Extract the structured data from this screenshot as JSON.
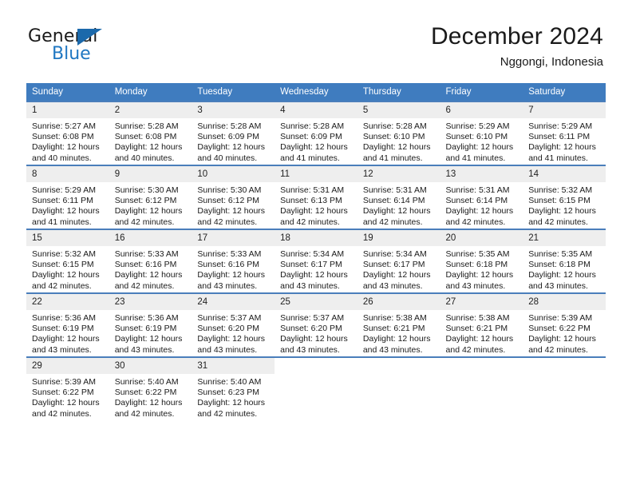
{
  "brand": {
    "name_part1": "General",
    "name_part2": "Blue"
  },
  "header": {
    "title": "December 2024",
    "subtitle": "Nggongi, Indonesia"
  },
  "calendar": {
    "weekday_headers": [
      "Sunday",
      "Monday",
      "Tuesday",
      "Wednesday",
      "Thursday",
      "Friday",
      "Saturday"
    ],
    "colors": {
      "header_bg": "#3f7cbf",
      "header_text": "#ffffff",
      "daynum_bg": "#eeeeee",
      "row_rule": "#4a7ebb",
      "brand_blue": "#1f77c2"
    },
    "weeks": [
      [
        {
          "day": "1",
          "sunrise": "Sunrise: 5:27 AM",
          "sunset": "Sunset: 6:08 PM",
          "daylight1": "Daylight: 12 hours",
          "daylight2": "and 40 minutes."
        },
        {
          "day": "2",
          "sunrise": "Sunrise: 5:28 AM",
          "sunset": "Sunset: 6:08 PM",
          "daylight1": "Daylight: 12 hours",
          "daylight2": "and 40 minutes."
        },
        {
          "day": "3",
          "sunrise": "Sunrise: 5:28 AM",
          "sunset": "Sunset: 6:09 PM",
          "daylight1": "Daylight: 12 hours",
          "daylight2": "and 40 minutes."
        },
        {
          "day": "4",
          "sunrise": "Sunrise: 5:28 AM",
          "sunset": "Sunset: 6:09 PM",
          "daylight1": "Daylight: 12 hours",
          "daylight2": "and 41 minutes."
        },
        {
          "day": "5",
          "sunrise": "Sunrise: 5:28 AM",
          "sunset": "Sunset: 6:10 PM",
          "daylight1": "Daylight: 12 hours",
          "daylight2": "and 41 minutes."
        },
        {
          "day": "6",
          "sunrise": "Sunrise: 5:29 AM",
          "sunset": "Sunset: 6:10 PM",
          "daylight1": "Daylight: 12 hours",
          "daylight2": "and 41 minutes."
        },
        {
          "day": "7",
          "sunrise": "Sunrise: 5:29 AM",
          "sunset": "Sunset: 6:11 PM",
          "daylight1": "Daylight: 12 hours",
          "daylight2": "and 41 minutes."
        }
      ],
      [
        {
          "day": "8",
          "sunrise": "Sunrise: 5:29 AM",
          "sunset": "Sunset: 6:11 PM",
          "daylight1": "Daylight: 12 hours",
          "daylight2": "and 41 minutes."
        },
        {
          "day": "9",
          "sunrise": "Sunrise: 5:30 AM",
          "sunset": "Sunset: 6:12 PM",
          "daylight1": "Daylight: 12 hours",
          "daylight2": "and 42 minutes."
        },
        {
          "day": "10",
          "sunrise": "Sunrise: 5:30 AM",
          "sunset": "Sunset: 6:12 PM",
          "daylight1": "Daylight: 12 hours",
          "daylight2": "and 42 minutes."
        },
        {
          "day": "11",
          "sunrise": "Sunrise: 5:31 AM",
          "sunset": "Sunset: 6:13 PM",
          "daylight1": "Daylight: 12 hours",
          "daylight2": "and 42 minutes."
        },
        {
          "day": "12",
          "sunrise": "Sunrise: 5:31 AM",
          "sunset": "Sunset: 6:14 PM",
          "daylight1": "Daylight: 12 hours",
          "daylight2": "and 42 minutes."
        },
        {
          "day": "13",
          "sunrise": "Sunrise: 5:31 AM",
          "sunset": "Sunset: 6:14 PM",
          "daylight1": "Daylight: 12 hours",
          "daylight2": "and 42 minutes."
        },
        {
          "day": "14",
          "sunrise": "Sunrise: 5:32 AM",
          "sunset": "Sunset: 6:15 PM",
          "daylight1": "Daylight: 12 hours",
          "daylight2": "and 42 minutes."
        }
      ],
      [
        {
          "day": "15",
          "sunrise": "Sunrise: 5:32 AM",
          "sunset": "Sunset: 6:15 PM",
          "daylight1": "Daylight: 12 hours",
          "daylight2": "and 42 minutes."
        },
        {
          "day": "16",
          "sunrise": "Sunrise: 5:33 AM",
          "sunset": "Sunset: 6:16 PM",
          "daylight1": "Daylight: 12 hours",
          "daylight2": "and 42 minutes."
        },
        {
          "day": "17",
          "sunrise": "Sunrise: 5:33 AM",
          "sunset": "Sunset: 6:16 PM",
          "daylight1": "Daylight: 12 hours",
          "daylight2": "and 43 minutes."
        },
        {
          "day": "18",
          "sunrise": "Sunrise: 5:34 AM",
          "sunset": "Sunset: 6:17 PM",
          "daylight1": "Daylight: 12 hours",
          "daylight2": "and 43 minutes."
        },
        {
          "day": "19",
          "sunrise": "Sunrise: 5:34 AM",
          "sunset": "Sunset: 6:17 PM",
          "daylight1": "Daylight: 12 hours",
          "daylight2": "and 43 minutes."
        },
        {
          "day": "20",
          "sunrise": "Sunrise: 5:35 AM",
          "sunset": "Sunset: 6:18 PM",
          "daylight1": "Daylight: 12 hours",
          "daylight2": "and 43 minutes."
        },
        {
          "day": "21",
          "sunrise": "Sunrise: 5:35 AM",
          "sunset": "Sunset: 6:18 PM",
          "daylight1": "Daylight: 12 hours",
          "daylight2": "and 43 minutes."
        }
      ],
      [
        {
          "day": "22",
          "sunrise": "Sunrise: 5:36 AM",
          "sunset": "Sunset: 6:19 PM",
          "daylight1": "Daylight: 12 hours",
          "daylight2": "and 43 minutes."
        },
        {
          "day": "23",
          "sunrise": "Sunrise: 5:36 AM",
          "sunset": "Sunset: 6:19 PM",
          "daylight1": "Daylight: 12 hours",
          "daylight2": "and 43 minutes."
        },
        {
          "day": "24",
          "sunrise": "Sunrise: 5:37 AM",
          "sunset": "Sunset: 6:20 PM",
          "daylight1": "Daylight: 12 hours",
          "daylight2": "and 43 minutes."
        },
        {
          "day": "25",
          "sunrise": "Sunrise: 5:37 AM",
          "sunset": "Sunset: 6:20 PM",
          "daylight1": "Daylight: 12 hours",
          "daylight2": "and 43 minutes."
        },
        {
          "day": "26",
          "sunrise": "Sunrise: 5:38 AM",
          "sunset": "Sunset: 6:21 PM",
          "daylight1": "Daylight: 12 hours",
          "daylight2": "and 43 minutes."
        },
        {
          "day": "27",
          "sunrise": "Sunrise: 5:38 AM",
          "sunset": "Sunset: 6:21 PM",
          "daylight1": "Daylight: 12 hours",
          "daylight2": "and 42 minutes."
        },
        {
          "day": "28",
          "sunrise": "Sunrise: 5:39 AM",
          "sunset": "Sunset: 6:22 PM",
          "daylight1": "Daylight: 12 hours",
          "daylight2": "and 42 minutes."
        }
      ],
      [
        {
          "day": "29",
          "sunrise": "Sunrise: 5:39 AM",
          "sunset": "Sunset: 6:22 PM",
          "daylight1": "Daylight: 12 hours",
          "daylight2": "and 42 minutes."
        },
        {
          "day": "30",
          "sunrise": "Sunrise: 5:40 AM",
          "sunset": "Sunset: 6:22 PM",
          "daylight1": "Daylight: 12 hours",
          "daylight2": "and 42 minutes."
        },
        {
          "day": "31",
          "sunrise": "Sunrise: 5:40 AM",
          "sunset": "Sunset: 6:23 PM",
          "daylight1": "Daylight: 12 hours",
          "daylight2": "and 42 minutes."
        },
        {
          "day": "",
          "sunrise": "",
          "sunset": "",
          "daylight1": "",
          "daylight2": ""
        },
        {
          "day": "",
          "sunrise": "",
          "sunset": "",
          "daylight1": "",
          "daylight2": ""
        },
        {
          "day": "",
          "sunrise": "",
          "sunset": "",
          "daylight1": "",
          "daylight2": ""
        },
        {
          "day": "",
          "sunrise": "",
          "sunset": "",
          "daylight1": "",
          "daylight2": ""
        }
      ]
    ]
  }
}
